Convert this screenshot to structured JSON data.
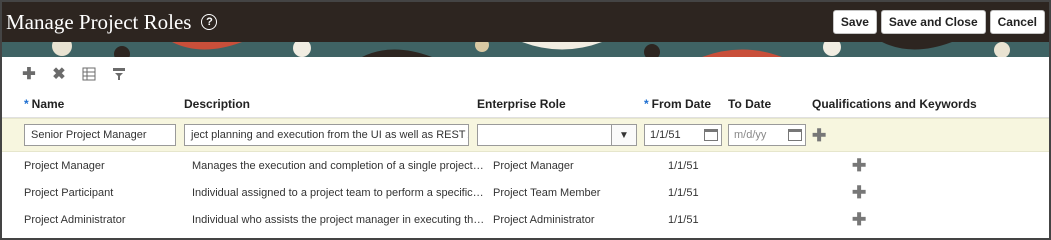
{
  "header": {
    "title": "Manage Project Roles",
    "help_icon": "?",
    "buttons": {
      "save": "Save",
      "save_close": "Save and Close",
      "cancel": "Cancel"
    }
  },
  "toolbar": {
    "icons": [
      "add-icon",
      "delete-icon",
      "freeze-column-icon",
      "filter-icon"
    ]
  },
  "columns": {
    "name": "Name",
    "description": "Description",
    "enterprise_role": "Enterprise Role",
    "from_date": "From Date",
    "to_date": "To Date",
    "qualifications": "Qualifications and Keywords"
  },
  "edit_row": {
    "name": "Senior Project Manager",
    "description": "ject planning and execution from the UI as well as REST APIs",
    "enterprise_role": "",
    "from_date": "1/1/51",
    "to_date_placeholder": "m/d/yy"
  },
  "rows": [
    {
      "name": "Project Manager",
      "description": "Manages the execution and completion of a single project. Cr...",
      "enterprise_role": "Project Manager",
      "from_date": "1/1/51"
    },
    {
      "name": "Project Participant",
      "description": "Individual assigned to a project team to perform a specific rol...",
      "enterprise_role": "Project Team Member",
      "from_date": "1/1/51"
    },
    {
      "name": "Project Administrator",
      "description": "Individual who assists the project manager in executing the a...",
      "enterprise_role": "Project Administrator",
      "from_date": "1/1/51"
    }
  ],
  "colors": {
    "header_bg": "#2d2520",
    "edit_row_bg": "#f7f6df",
    "required_mark": "#1d6fd1"
  }
}
